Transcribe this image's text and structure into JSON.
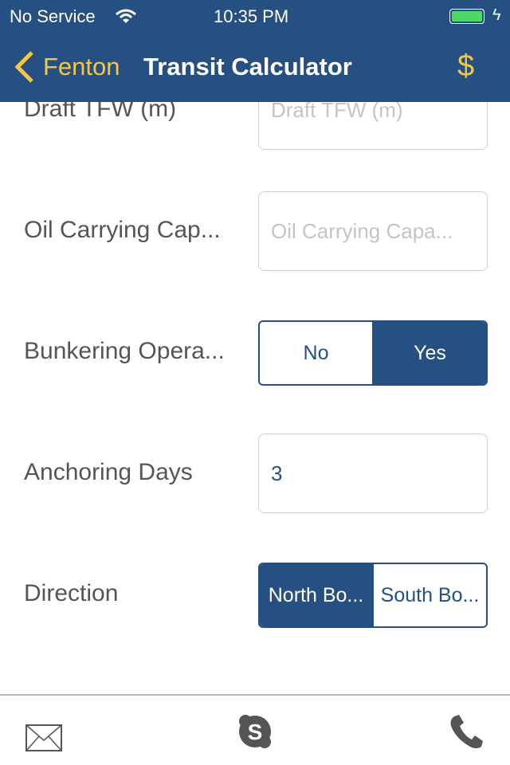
{
  "status": {
    "carrier": "No Service",
    "time": "10:35 PM"
  },
  "nav": {
    "back_label": "Fenton",
    "title": "Transit Calculator",
    "action_icon": "dollar-icon"
  },
  "colors": {
    "brand": "#264f82",
    "accent": "#f5c842"
  },
  "form": [
    {
      "label": "Draft TFW (m)",
      "placeholder": "Draft TFW (m)"
    },
    {
      "label": "Oil Carrying Cap...",
      "placeholder": "Oil Carrying Capa..."
    },
    {
      "label": "Bunkering Opera...",
      "options": [
        "No",
        "Yes"
      ],
      "selected": "Yes"
    },
    {
      "label": "Anchoring Days",
      "value": "3"
    },
    {
      "label": "Direction",
      "options": [
        "North Bo...",
        "South Bo..."
      ],
      "selected": "North Bo..."
    }
  ],
  "tabbar": [
    "mail-icon",
    "skype-icon",
    "phone-icon"
  ]
}
